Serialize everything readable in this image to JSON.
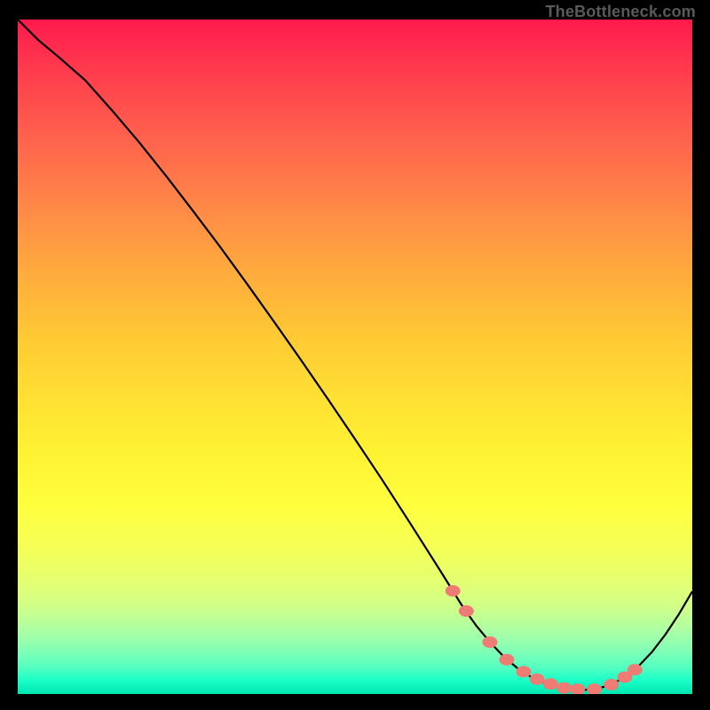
{
  "attribution": "TheBottleneck.com",
  "colors": {
    "background": "#000000",
    "curve": "#000000",
    "marker": "#ef7c74"
  },
  "chart_data": {
    "type": "line",
    "title": "",
    "xlabel": "",
    "ylabel": "",
    "xlim": [
      0,
      100
    ],
    "ylim": [
      0,
      100
    ],
    "x": [
      0,
      3,
      6,
      10,
      14,
      18,
      22,
      26,
      30,
      34,
      38,
      42,
      46,
      50,
      54,
      58,
      62,
      64,
      66,
      68,
      70,
      72,
      74,
      76,
      78,
      80,
      82,
      84,
      86,
      88,
      90,
      92,
      94,
      96,
      98,
      100
    ],
    "y": [
      100,
      97,
      94.5,
      91,
      86.5,
      81.8,
      76.8,
      71.6,
      66.3,
      60.8,
      55.2,
      49.5,
      43.7,
      37.8,
      31.8,
      25.6,
      19.3,
      16.1,
      12.9,
      10.1,
      7.7,
      5.6,
      3.9,
      2.6,
      1.7,
      1.1,
      0.7,
      0.6,
      0.8,
      1.4,
      2.5,
      4.1,
      6.2,
      8.8,
      11.8,
      15.2
    ],
    "markers_x": [
      64.5,
      66.5,
      70,
      72.5,
      75,
      77,
      79,
      81,
      83,
      85.5,
      88,
      90,
      91.5
    ],
    "markers_y": [
      15.3,
      12.3,
      7.7,
      5.1,
      3.3,
      2.2,
      1.5,
      0.9,
      0.7,
      0.7,
      1.4,
      2.5,
      3.6
    ],
    "background_gradient": {
      "top": "#ff1a4d",
      "middle": "#ffee33",
      "bottom": "#00e6b0"
    }
  }
}
